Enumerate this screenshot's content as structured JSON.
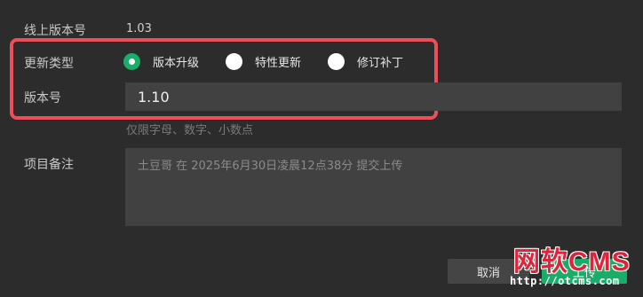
{
  "form": {
    "current_version": {
      "label": "线上版本号",
      "value": "1.03"
    },
    "update_type": {
      "label": "更新类型",
      "options": [
        {
          "label": "版本升级",
          "checked": true
        },
        {
          "label": "特性更新",
          "checked": false
        },
        {
          "label": "修订补丁",
          "checked": false
        }
      ]
    },
    "version_number": {
      "label": "版本号",
      "value": "1.10",
      "hint": "仅限字母、数字、小数点"
    },
    "remark": {
      "label": "项目备注",
      "placeholder": "土豆哥 在 2025年6月30日凌晨12点38分 提交上传"
    }
  },
  "buttons": {
    "cancel_label": "取消",
    "upload_label": "上传"
  },
  "colors": {
    "background": "#2c2c2c",
    "input_background": "#414141",
    "accent_green": "#1aad6a",
    "highlight_red": "#f04d5a"
  },
  "watermark": {
    "title": "网软CMS",
    "url": "http://otcms.com"
  }
}
